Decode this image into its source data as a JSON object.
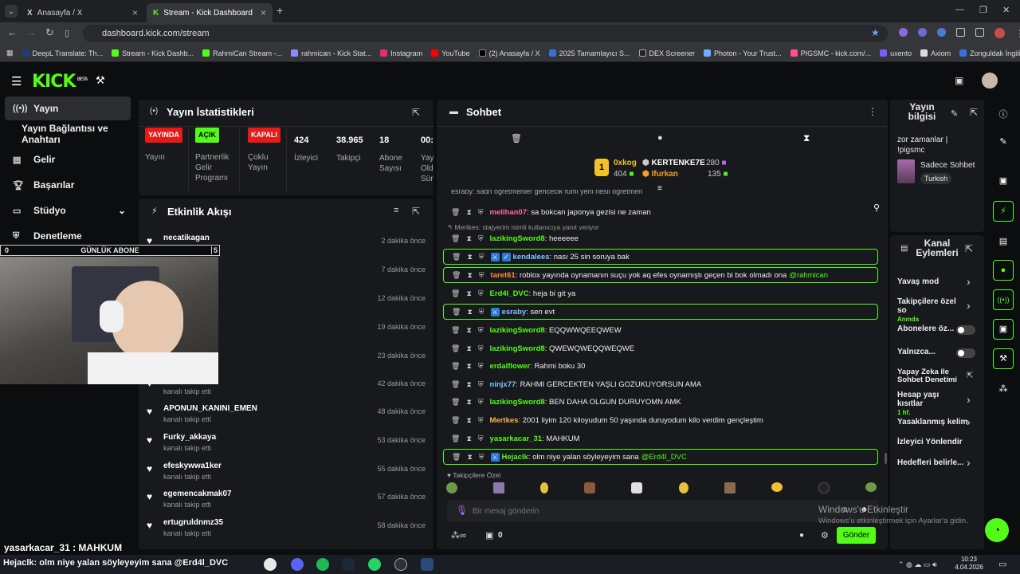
{
  "browser": {
    "tabs": [
      {
        "title": "Anasayfa / X",
        "icon": "x-icon"
      },
      {
        "title": "Stream - Kick Dashboard",
        "icon": "kick-icon"
      }
    ],
    "url": "dashboard.kick.com/stream",
    "bookmarks": [
      "DeepL Translate: Th...",
      "Stream - Kick Dashb...",
      "RahmiCan Stream -...",
      "rahmican - Kick Stat...",
      "Instagram",
      "YouTube",
      "(2) Anasayfa / X",
      "2025 Tamamlayıcı S...",
      "DEX Screener",
      "Photon - Your Trust...",
      "PIGSMC - kick.com/...",
      "uxento",
      "Axiom",
      "Zonguldak İngilizce..."
    ]
  },
  "app": {
    "logo": "KICK",
    "logo_sup": "BETA"
  },
  "sidebar": {
    "items": [
      {
        "label": "Yayın",
        "icon": "broadcast-icon",
        "active": true
      },
      {
        "label": "Yayın Bağlantısı ve Anahtarı",
        "icon": "",
        "active": false
      },
      {
        "label": "Gelir",
        "icon": "money-icon",
        "active": false
      },
      {
        "label": "Başarılar",
        "icon": "trophy-icon",
        "active": false
      },
      {
        "label": "Stüdyo",
        "icon": "studio-icon",
        "active": false
      },
      {
        "label": "Denetleme",
        "icon": "shield-icon",
        "active": false
      }
    ]
  },
  "goal_bar": {
    "left": "0",
    "label": "GÜNLÜK ABONE",
    "right": "5"
  },
  "stats": {
    "title": "Yayın İstatistikleri",
    "items": [
      {
        "badge": "YAYINDA",
        "badge_color": "#e91916",
        "label": "Yayın"
      },
      {
        "badge": "AÇIK",
        "badge_color": "#53fc18",
        "label": "Partnerlik Gelir Programı"
      },
      {
        "badge": "KAPALI",
        "badge_color": "#e91916",
        "label": "Çoklu Yayın"
      },
      {
        "value": "424",
        "label": "İzleyici"
      },
      {
        "value": "38.965",
        "label": "Takipçi"
      },
      {
        "value": "18",
        "label": "Abone Sayısı"
      },
      {
        "value": "00:5",
        "label": "Yay Old Sür"
      }
    ]
  },
  "activity": {
    "title": "Etkinlik Akışı",
    "items": [
      {
        "name": "necatikagan",
        "action": "kanalı takip etti",
        "time": "2 dakika önce"
      },
      {
        "name": "",
        "action": "",
        "time": "7 dakika önce"
      },
      {
        "name": "",
        "action": "",
        "time": "12 dakika önce"
      },
      {
        "name": "",
        "action": "",
        "time": "19 dakika önce"
      },
      {
        "name": "",
        "action": "",
        "time": "23 dakika önce"
      },
      {
        "name": "",
        "action": "kanalı takip etti",
        "time": "42 dakika önce"
      },
      {
        "name": "APONUN_KANINI_EMEN",
        "action": "kanalı takip etti",
        "time": "48 dakika önce"
      },
      {
        "name": "Furky_akkaya",
        "action": "kanalı takip etti",
        "time": "53 dakika önce"
      },
      {
        "name": "efeskywwa1ker",
        "action": "kanalı takip etti",
        "time": "55 dakika önce"
      },
      {
        "name": "egemencakmak07",
        "action": "kanalı takip etti",
        "time": "57 dakika önce"
      },
      {
        "name": "ertugruldnmz35",
        "action": "kanalı takip etti",
        "time": "58 dakika önce"
      }
    ]
  },
  "chat": {
    "title": "Sohbet",
    "leaderboard": [
      {
        "rank": "1",
        "name": "0xkog",
        "value": "404"
      },
      {
        "name": "KERTENKE7E",
        "value": "280"
      },
      {
        "name": "Ifurkan",
        "value": "135"
      }
    ],
    "top_partial": "esraby: sadn ogretmenler gencecik fumi yeni nesli ogretmen",
    "reply_note": "Mertkes: stajyerim isimli kullanıcıya yanıt veriyor",
    "messages": [
      {
        "user": "melihan07",
        "color": "#ff6b9a",
        "text": "sa bokcan japonya gezisi ne zaman",
        "hl": false,
        "badges": 0
      },
      {
        "user": "lazikingSword8",
        "color": "#53fc18",
        "text": "heeeeee",
        "hl": false,
        "badges": 0
      },
      {
        "user": "kendalees",
        "color": "#79c7ff",
        "text": "nası 25 sin soruya bak",
        "hl": true,
        "badges": 2
      },
      {
        "user": "taret61",
        "color": "#ff8c3a",
        "text": "roblox yayında oynamanın suçu yok aq efes oynamıştı geçen bi bok olmadı ona",
        "mention": "@rahmican",
        "hl": true,
        "badges": 0
      },
      {
        "user": "Erd4l_DVC",
        "color": "#53fc18",
        "text": "heja bi git ya",
        "hl": false,
        "badges": 0
      },
      {
        "user": "esraby",
        "color": "#79c7ff",
        "text": "sen evt",
        "hl": true,
        "badges": 1
      },
      {
        "user": "lazikingSword8",
        "color": "#53fc18",
        "text": "EQQWWQEEQWEW",
        "hl": false,
        "badges": 0
      },
      {
        "user": "lazikingSword8",
        "color": "#53fc18",
        "text": "QWEWQWEQQWEQWE",
        "hl": false,
        "badges": 0
      },
      {
        "user": "erdalflower",
        "color": "#53fc18",
        "text": "Rahmi boku 30",
        "hl": false,
        "badges": 0
      },
      {
        "user": "ninjx77",
        "color": "#79c7ff",
        "text": "RAHMI GERCEKTEN YAŞLI GOZUKUYORSUN AMA",
        "hl": false,
        "badges": 0
      },
      {
        "user": "lazikingSword8",
        "color": "#53fc18",
        "text": "BEN DAHA OLGUN DURUYOMN AMK",
        "hl": false,
        "badges": 0
      },
      {
        "user": "Mertkes",
        "color": "#ffb24a",
        "text": "2001 liyim 120 kiloyudum 50 yaşında duruyodum kilo verdim gençleştim",
        "hl": false,
        "badges": 0
      },
      {
        "user": "yasarkacar_31",
        "color": "#53fc18",
        "text": "MAHKUM",
        "hl": false,
        "badges": 0
      },
      {
        "user": "Hejaclk",
        "color": "#53fc18",
        "text": "olm niye yalan söyleyeyim sana",
        "mention": "@Erd4l_DVC",
        "hl": true,
        "badges": 1
      }
    ],
    "emote_label": "Takipçilere Özel",
    "input_placeholder": "Bir mesaj gönderin",
    "count": "0",
    "send": "Gönder"
  },
  "stream_info": {
    "title": "Yayın bilgisi",
    "stream_title": "zor zamanlar | !pigsmc",
    "mode": "Sadece Sohbet",
    "language": "Turkish"
  },
  "channel_actions": {
    "title": "Kanal Eylemleri",
    "items": [
      {
        "label": "Yavaş mod",
        "sub": "",
        "kind": "chevron"
      },
      {
        "label": "Takipçilere özel so",
        "sub": "Anında",
        "kind": "chevron"
      },
      {
        "label": "Abonelere öz...",
        "sub": "",
        "kind": "toggle"
      },
      {
        "label": "Yalnızca...",
        "sub": "",
        "kind": "toggle"
      },
      {
        "label": "Yapay Zeka ile Sohbet Denetimi",
        "sub": "",
        "kind": "external"
      },
      {
        "label": "Hesap yaşı kısıtlar",
        "sub": "1 hf.",
        "kind": "chevron"
      },
      {
        "label": "Yasaklanmış kelim",
        "sub": "",
        "kind": "chevron"
      },
      {
        "label": "İzleyici Yönlendir",
        "sub": "",
        "kind": "none"
      },
      {
        "label": "Hedefleri belirle...",
        "sub": "",
        "kind": "chevron"
      }
    ]
  },
  "overlay": {
    "caption1": "yasarkacar_31 : MAHKUM",
    "caption2": "Hejaclk: olm niye yalan söyleyeyim sana @Erd4l_DVC"
  },
  "windows": {
    "activate_title": "Windows'u Etkinleştir",
    "activate_sub": "Windows'u etkinleştirmek için Ayarlar'a gidin.",
    "time": "10:23",
    "date": "4.04.2026"
  },
  "colors": {
    "accent": "#53fc18",
    "live": "#e91916",
    "panel": "#18191c"
  }
}
